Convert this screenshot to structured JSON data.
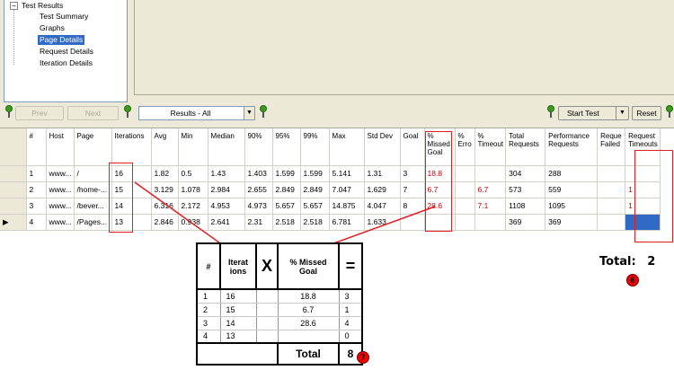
{
  "tree": {
    "root": "Test Results",
    "items": [
      {
        "label": "Test Summary",
        "selected": false
      },
      {
        "label": "Graphs",
        "selected": false
      },
      {
        "label": "Page Details",
        "selected": true
      },
      {
        "label": "Request Details",
        "selected": false
      },
      {
        "label": "Iteration Details",
        "selected": false
      }
    ]
  },
  "toolbar": {
    "prev": "Prev",
    "next": "Next",
    "results_select": "Results - All",
    "start_test": "Start Test",
    "reset": "Reset"
  },
  "grid": {
    "headers": [
      "#",
      "Host",
      "Page",
      "Iterations",
      "Avg",
      "Min",
      "Median",
      "90%",
      "95%",
      "99%",
      "Max",
      "Std Dev",
      "Goal",
      "% Missed Goal",
      "% Erro",
      "% Timeout",
      "Total Requests",
      "Performance Requests",
      "Reque Failed",
      "Request Timeouts"
    ],
    "rows": [
      {
        "cells": [
          "1",
          "www...",
          "/",
          "16",
          "1.82",
          "0.5",
          "1.43",
          "1.403",
          "1.599",
          "1.599",
          "5.141",
          "1.31",
          "3",
          "18.8",
          "",
          "",
          "304",
          "288",
          "",
          ""
        ]
      },
      {
        "cells": [
          "2",
          "www...",
          "/home-...",
          "15",
          "3.129",
          "1.078",
          "2.984",
          "2.655",
          "2.849",
          "2.849",
          "7.047",
          "1.629",
          "7",
          "6.7",
          "",
          "6.7",
          "573",
          "559",
          "",
          "1"
        ]
      },
      {
        "cells": [
          "3",
          "www...",
          "/bever...",
          "14",
          "6.316",
          "2.172",
          "4.953",
          "4.973",
          "5.657",
          "5.657",
          "14.875",
          "4.047",
          "8",
          "28.6",
          "",
          "7.1",
          "1108",
          "1095",
          "",
          "1"
        ]
      },
      {
        "cells": [
          "4",
          "www...",
          "/Pages...",
          "13",
          "2.846",
          "0.938",
          "2.641",
          "2.31",
          "2.518",
          "2.518",
          "6.781",
          "1.633",
          "",
          "",
          "",
          "",
          "369",
          "369",
          "",
          ""
        ]
      }
    ]
  },
  "math": {
    "headers": [
      "#",
      "Iterat ions",
      "X",
      "% Missed Goal",
      "="
    ],
    "rows": [
      [
        "1",
        "16",
        "",
        "18.8",
        "3"
      ],
      [
        "2",
        "15",
        "",
        "6.7",
        "1"
      ],
      [
        "3",
        "14",
        "",
        "28.6",
        "4"
      ],
      [
        "4",
        "13",
        "",
        "",
        "0"
      ]
    ],
    "total_label": "Total",
    "total_value": "8",
    "badge": "7"
  },
  "timeouts_total": {
    "label": "Total:",
    "value": "2",
    "badge": "6"
  },
  "colors": {
    "annotation": "#e02020",
    "selection": "#316ac5",
    "pin": "#3c9a1f"
  }
}
